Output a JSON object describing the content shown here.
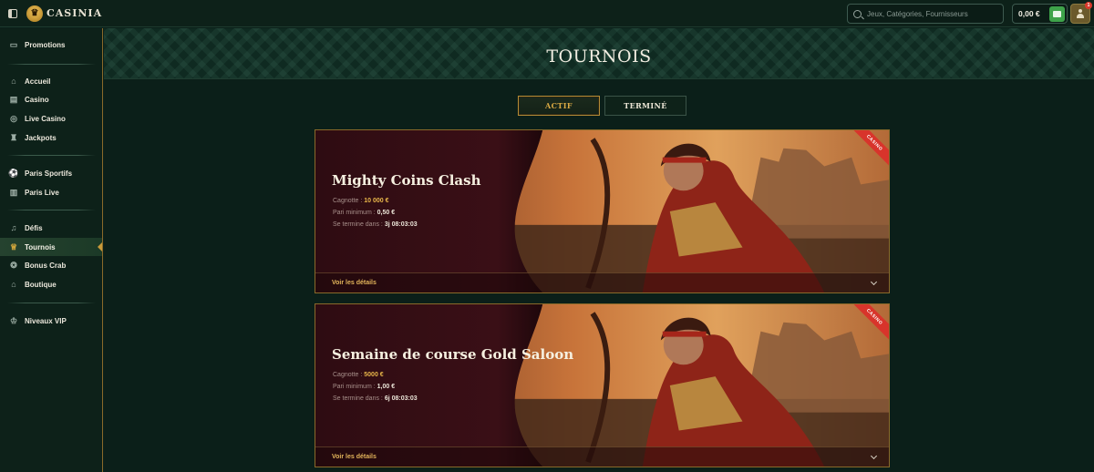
{
  "header": {
    "logo_text": "CASINIA",
    "search_placeholder": "Jeux, Catégories, Fournisseurs",
    "balance": "0,00 €",
    "notification_count": "1"
  },
  "sidebar": {
    "items": [
      {
        "label": "Promotions",
        "icon": "promotions-icon"
      },
      {
        "label": "Accueil",
        "icon": "home-icon"
      },
      {
        "label": "Casino",
        "icon": "casino-icon"
      },
      {
        "label": "Live Casino",
        "icon": "live-casino-icon"
      },
      {
        "label": "Jackpots",
        "icon": "jackpot-icon"
      },
      {
        "label": "Paris Sportifs",
        "icon": "sports-icon"
      },
      {
        "label": "Paris Live",
        "icon": "live-bets-icon"
      },
      {
        "label": "Défis",
        "icon": "challenges-icon"
      },
      {
        "label": "Tournois",
        "icon": "trophy-icon",
        "active": true
      },
      {
        "label": "Bonus Crab",
        "icon": "crab-icon"
      },
      {
        "label": "Boutique",
        "icon": "shop-icon"
      },
      {
        "label": "Niveaux VIP",
        "icon": "vip-crown-icon"
      }
    ]
  },
  "main": {
    "title": "TOURNOIS",
    "tabs": [
      {
        "label": "ACTIF",
        "active": true
      },
      {
        "label": "TERMINÉ",
        "active": false
      }
    ],
    "cards": [
      {
        "title": "Mighty Coins Clash",
        "ribbon": "CASINO",
        "prize_label": "Cagnotte :",
        "prize_value": "10 000 €",
        "min_bet_label": "Pari minimum :",
        "min_bet_value": "0,50 €",
        "ends_label": "Se termine dans :",
        "ends_value": "3j 08:03:03",
        "details_label": "Voir les détails"
      },
      {
        "title": "Semaine de course Gold Saloon",
        "ribbon": "CASINO",
        "prize_label": "Cagnotte :",
        "prize_value": "5000 €",
        "min_bet_label": "Pari minimum :",
        "min_bet_value": "1,00 €",
        "ends_label": "Se termine dans :",
        "ends_value": "6j 08:03:03",
        "details_label": "Voir les détails"
      }
    ]
  },
  "colors": {
    "background": "#0b1f19",
    "accent_gold": "#d9a943",
    "ribbon_red": "#d8342b",
    "wallet_green": "#3ea34a"
  }
}
